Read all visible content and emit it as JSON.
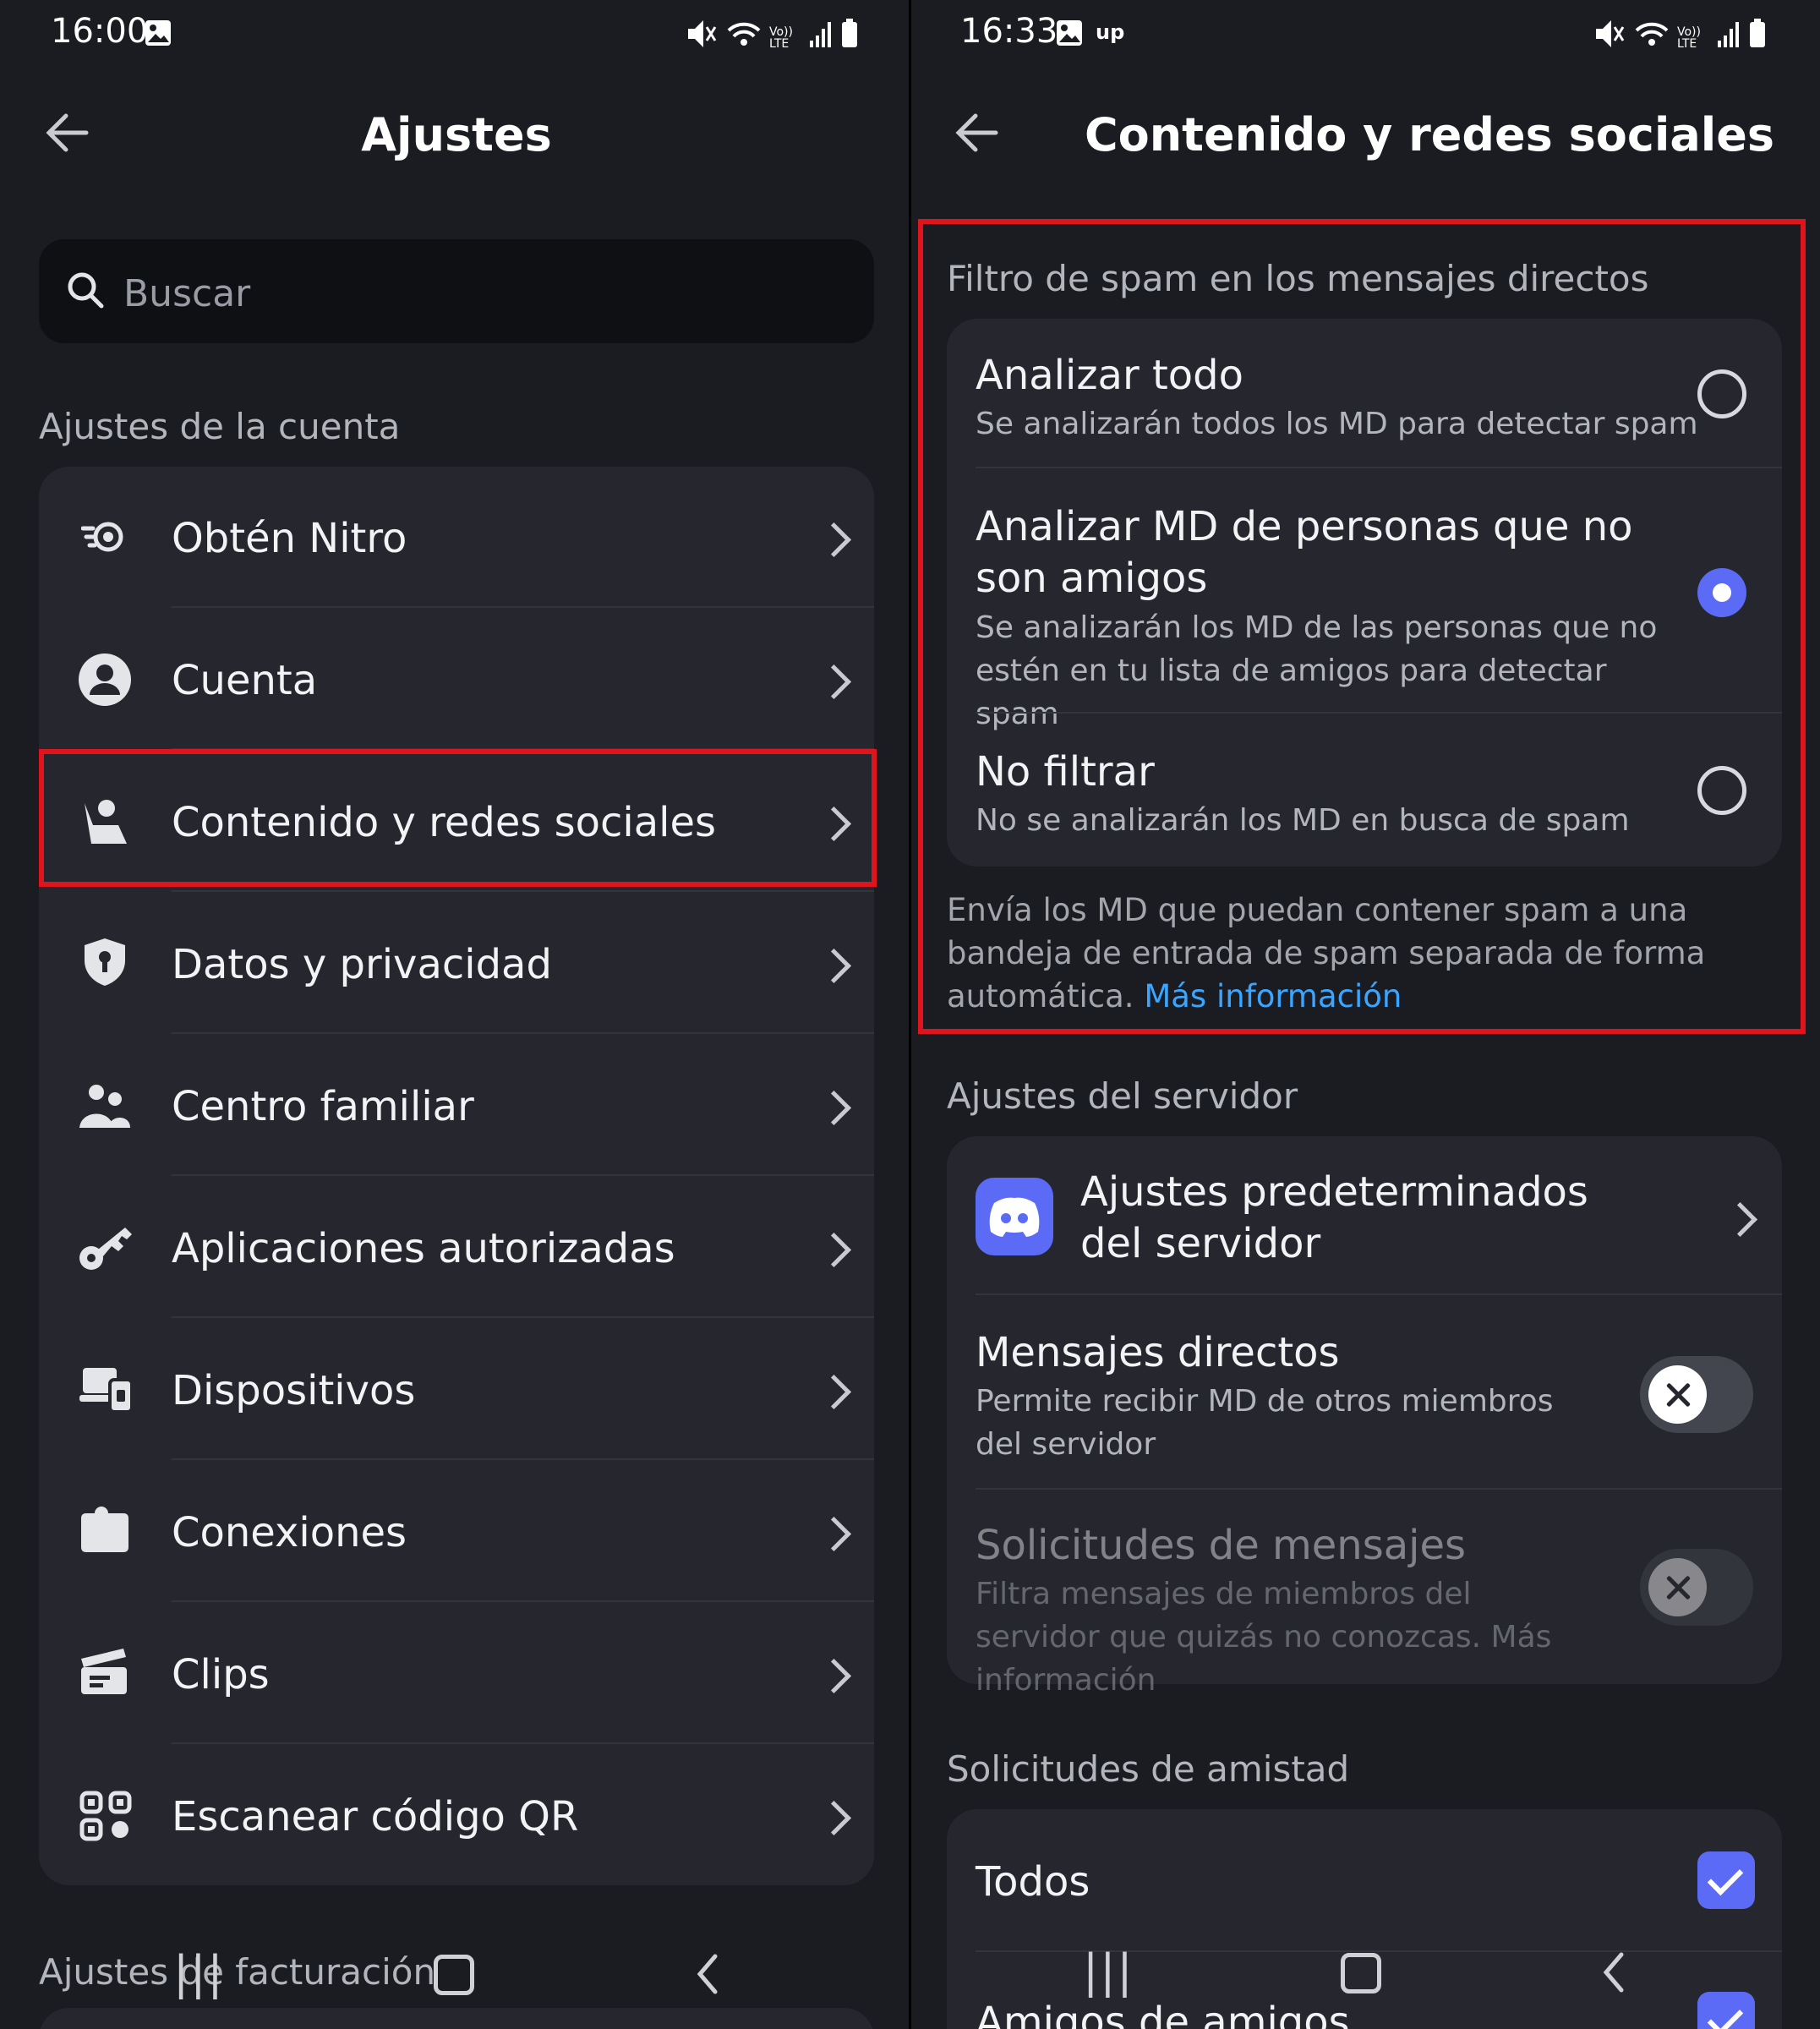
{
  "left": {
    "status_time": "16:00",
    "title": "Ajustes",
    "search_placeholder": "Buscar",
    "section_account": "Ajustes de la cuenta",
    "menu": [
      {
        "label": "Obtén Nitro",
        "icon": "nitro-icon"
      },
      {
        "label": "Cuenta",
        "icon": "account-icon"
      },
      {
        "label": "Contenido y redes sociales",
        "icon": "content-social-icon"
      },
      {
        "label": "Datos y privacidad",
        "icon": "shield-icon"
      },
      {
        "label": "Centro familiar",
        "icon": "family-icon"
      },
      {
        "label": "Aplicaciones autorizadas",
        "icon": "key-icon"
      },
      {
        "label": "Dispositivos",
        "icon": "devices-icon"
      },
      {
        "label": "Conexiones",
        "icon": "puzzle-icon"
      },
      {
        "label": "Clips",
        "icon": "clapperboard-icon"
      },
      {
        "label": "Escanear código QR",
        "icon": "qr-code-icon"
      }
    ],
    "section_billing": "Ajustes de facturación"
  },
  "right": {
    "status_time": "16:33",
    "title": "Contenido y redes sociales",
    "spam_section": "Filtro de spam en los mensajes directos",
    "spam_options": [
      {
        "title": "Analizar todo",
        "desc": "Se analizarán todos los MD para detectar spam",
        "selected": false
      },
      {
        "title": "Analizar MD de personas que no son amigos",
        "desc": "Se analizarán los MD de las personas que no estén en tu lista de amigos para detectar spam",
        "selected": true
      },
      {
        "title": "No filtrar",
        "desc": "No se analizarán los MD en busca de spam",
        "selected": false
      }
    ],
    "spam_footer": "Envía los MD que puedan contener spam a una bandeja de entrada de spam separada de forma automática.",
    "spam_footer_link": "Más información",
    "server_section": "Ajustes del servidor",
    "server_defaults": "Ajustes predeterminados del servidor",
    "dm_title": "Mensajes directos",
    "dm_desc": "Permite recibir MD de otros miembros del servidor",
    "dm_enabled": false,
    "requests_title": "Solicitudes de mensajes",
    "requests_desc": "Filtra mensajes de miembros del servidor que quizás no conozcas. Más información",
    "requests_enabled": false,
    "friend_section": "Solicitudes de amistad",
    "friend_all": "Todos",
    "friend_all_checked": true,
    "friend_fof": "Amigos de amigos",
    "friend_fof_checked": true
  }
}
